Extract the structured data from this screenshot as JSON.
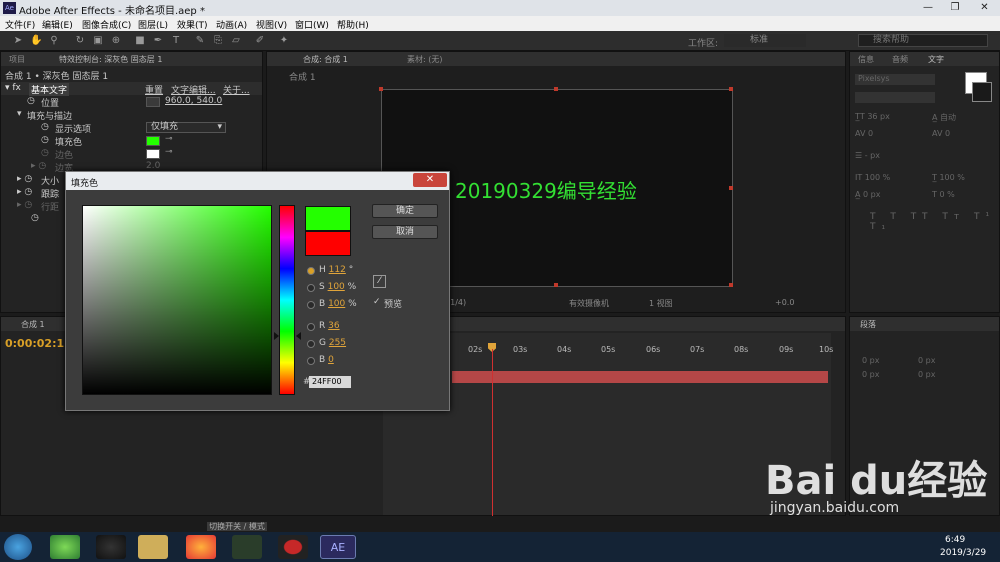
{
  "titlebar": {
    "icon": "Ae",
    "title": "Adobe After Effects - 未命名项目.aep *"
  },
  "menu": [
    "文件(F)",
    "编辑(E)",
    "图像合成(C)",
    "图层(L)",
    "效果(T)",
    "动画(A)",
    "视图(V)",
    "窗口(W)",
    "帮助(H)"
  ],
  "toolbar": {
    "workspace_label": "工作区:",
    "workspace_value": "标准",
    "search_placeholder": "搜索帮助"
  },
  "left_panel": {
    "tab1": "项目",
    "tab2": "特效控制台: 深灰色 固态层 1",
    "layer_path": "合成 1 • 深灰色 固态层 1",
    "effect_name": "基本文字",
    "reset": "重置",
    "edit_text": "文字编辑...",
    "about": "关于...",
    "position_label": "位置",
    "position_value": "960.0, 540.0",
    "fill_stroke": "填充与描边",
    "display_options": "显示选项",
    "display_value": "仅填充",
    "fill_color": "填充色",
    "stroke_color": "边色",
    "stroke_width": "边宽",
    "stroke_width_value": "2.0",
    "size": "大小",
    "tracking": "跟踪",
    "line_spacing": "行距"
  },
  "comp_panel": {
    "tab": "合成: 合成 1",
    "footage_tab": "素材: (无)",
    "sub_tab": "合成 1",
    "comp_text": "20190329编导经验",
    "resolution": "(1/4)",
    "camera": "有效摄像机",
    "views": "1 视图",
    "offset": "+0.0"
  },
  "right_panel": {
    "tabs": [
      "信息",
      "音频",
      "文字"
    ],
    "font": "Pixelsys",
    "size": "36 px",
    "leading": "自动",
    "kerning": "0",
    "tracking": "0",
    "vscale": "100 %",
    "hscale": "100 %",
    "baseline": "0 px",
    "tsume": "0 %",
    "para_tab": "段落",
    "para_vals": [
      "0 px",
      "0 px",
      "0 px",
      "0 px",
      "0 px"
    ],
    "indent_val": "- px"
  },
  "dialog": {
    "title": "填充色",
    "ok": "确定",
    "cancel": "取消",
    "h_label": "H",
    "h_value": "112",
    "h_unit": "°",
    "s_label": "S",
    "s_value": "100",
    "s_unit": "%",
    "b_label": "B",
    "b_value": "100",
    "b_unit": "%",
    "r_label": "R",
    "r_value": "36",
    "g_label": "G",
    "g_value": "255",
    "bl_label": "B",
    "bl_value": "0",
    "hash": "#",
    "hex": "24FF00",
    "preview": "预览",
    "new_color": "#24ff00",
    "old_color": "#ff0000"
  },
  "timeline": {
    "tab": "合成 1",
    "timecode": "0:00:02:1",
    "ruler": [
      "02s",
      "03s",
      "04s",
      "05s",
      "06s",
      "07s",
      "08s",
      "09s",
      "10s"
    ],
    "switch_label": "切换开关 / 模式"
  },
  "taskbar": {
    "time": "6:49",
    "date": "2019/3/29",
    "ae_label": "AE"
  },
  "watermark": {
    "brand": "Bai du经验",
    "url": "jingyan.baidu.com"
  }
}
